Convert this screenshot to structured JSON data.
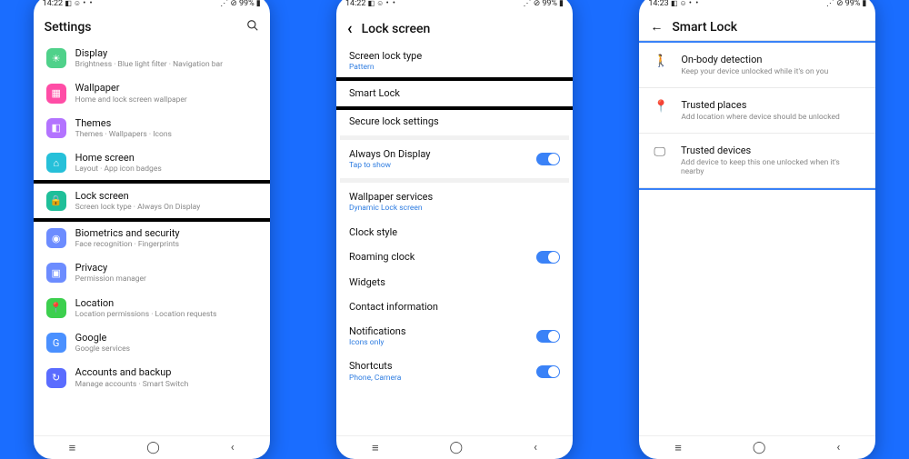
{
  "status": {
    "time1": "14:22",
    "time3": "14:23",
    "battery": "99%"
  },
  "phone1": {
    "title": "Settings",
    "rows": [
      {
        "label": "Display",
        "sub": "Brightness · Blue light filter · Navigation bar",
        "color": "#4fd18a",
        "glyph": "☀"
      },
      {
        "label": "Wallpaper",
        "sub": "Home and lock screen wallpaper",
        "color": "#ff4da6",
        "glyph": "▦"
      },
      {
        "label": "Themes",
        "sub": "Themes · Wallpapers · Icons",
        "color": "#b373ff",
        "glyph": "◧"
      },
      {
        "label": "Home screen",
        "sub": "Layout · App icon badges",
        "color": "#26c0d9",
        "glyph": "⌂"
      },
      {
        "label": "Lock screen",
        "sub": "Screen lock type · Always On Display",
        "color": "#1fbf99",
        "glyph": "🔒",
        "callout": true
      },
      {
        "label": "Biometrics and security",
        "sub": "Face recognition · Fingerprints",
        "color": "#6c8cff",
        "glyph": "◉"
      },
      {
        "label": "Privacy",
        "sub": "Permission manager",
        "color": "#6c8cff",
        "glyph": "▣"
      },
      {
        "label": "Location",
        "sub": "Location permissions · Location requests",
        "color": "#3ccf4e",
        "glyph": "📍"
      },
      {
        "label": "Google",
        "sub": "Google services",
        "color": "#4a90ff",
        "glyph": "G"
      },
      {
        "label": "Accounts and backup",
        "sub": "Manage accounts · Smart Switch",
        "color": "#5a6cff",
        "glyph": "↻"
      }
    ]
  },
  "phone2": {
    "title": "Lock screen",
    "sections": [
      [
        {
          "label": "Screen lock type",
          "sub": "Pattern",
          "link": true
        },
        {
          "label": "Smart Lock",
          "callout": true
        },
        {
          "label": "Secure lock settings"
        }
      ],
      [
        {
          "label": "Always On Display",
          "sub": "Tap to show",
          "link": true,
          "toggle": true
        }
      ],
      [
        {
          "label": "Wallpaper services",
          "sub": "Dynamic Lock screen",
          "link": true
        },
        {
          "label": "Clock style"
        },
        {
          "label": "Roaming clock",
          "toggle": true
        },
        {
          "label": "Widgets"
        },
        {
          "label": "Contact information"
        },
        {
          "label": "Notifications",
          "sub": "Icons only",
          "link": true,
          "toggle": true
        },
        {
          "label": "Shortcuts",
          "sub": "Phone, Camera",
          "link": true,
          "toggle": true
        }
      ]
    ]
  },
  "phone3": {
    "title": "Smart Lock",
    "rows": [
      {
        "icon": "🚶",
        "label": "On-body detection",
        "sub": "Keep your device unlocked while it's on you"
      },
      {
        "icon": "📍",
        "label": "Trusted places",
        "sub": "Add location where device should be unlocked"
      },
      {
        "icon": "🖵",
        "label": "Trusted devices",
        "sub": "Add device to keep this one unlocked when it's nearby"
      }
    ]
  }
}
